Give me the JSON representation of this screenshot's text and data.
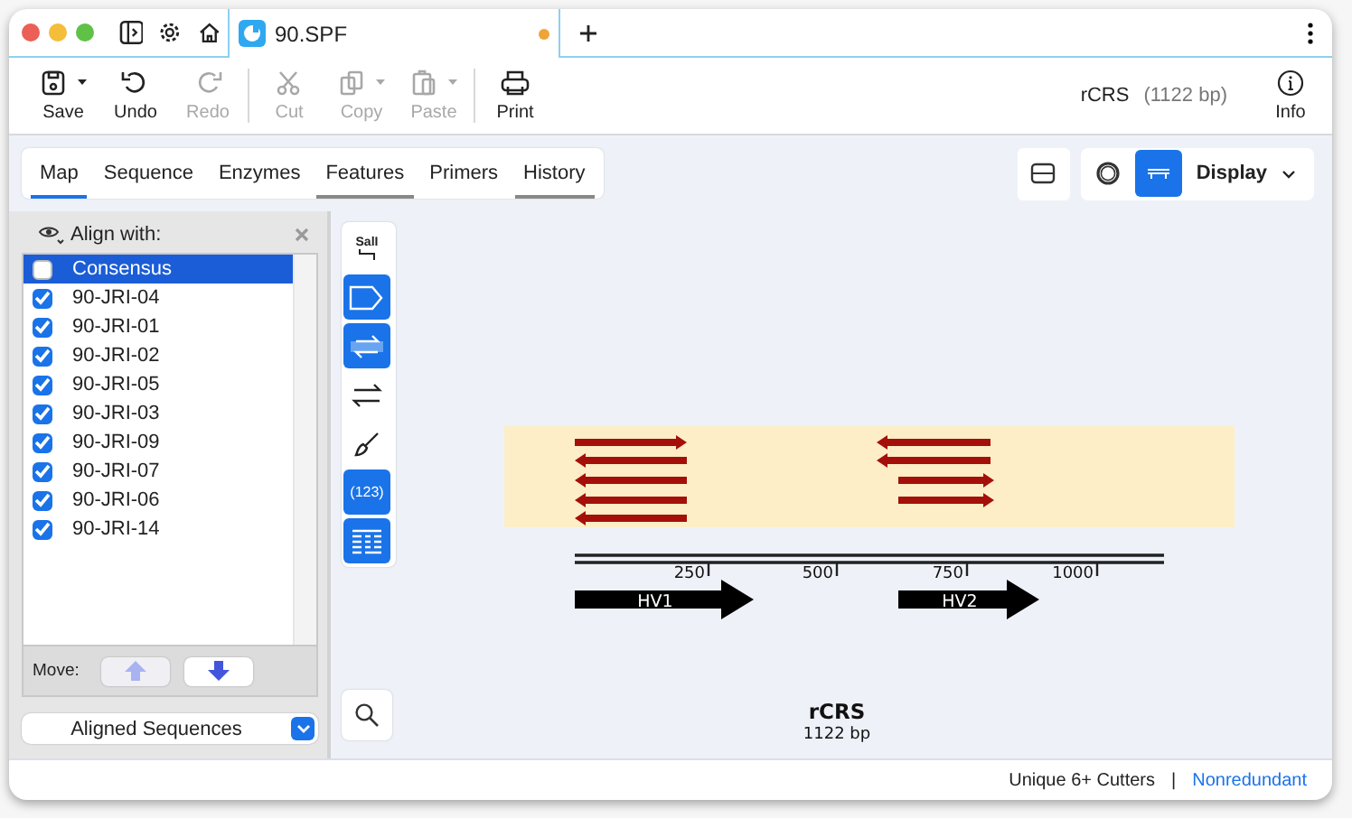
{
  "window": {
    "tab": {
      "title": "90.SPF",
      "modified": true
    }
  },
  "toolbar": {
    "groups": [
      [
        {
          "kind": "save",
          "label": "Save",
          "menu": true,
          "disabled": false
        },
        {
          "kind": "undo",
          "label": "Undo",
          "menu": false,
          "disabled": false
        },
        {
          "kind": "redo",
          "label": "Redo",
          "menu": false,
          "disabled": true
        }
      ],
      [
        {
          "kind": "cut",
          "label": "Cut",
          "menu": false,
          "disabled": true
        },
        {
          "kind": "copy",
          "label": "Copy",
          "menu": true,
          "disabled": true
        },
        {
          "kind": "paste",
          "label": "Paste",
          "menu": true,
          "disabled": true
        }
      ],
      [
        {
          "kind": "print",
          "label": "Print",
          "menu": false,
          "disabled": false
        }
      ]
    ],
    "sequence_name": "rCRS",
    "sequence_length": "(1122 bp)",
    "info_label": "Info"
  },
  "tabs": [
    {
      "label": "Map",
      "selected": true,
      "has_content": false
    },
    {
      "label": "Sequence",
      "selected": false,
      "has_content": false
    },
    {
      "label": "Enzymes",
      "selected": false,
      "has_content": false
    },
    {
      "label": "Features",
      "selected": false,
      "has_content": true
    },
    {
      "label": "Primers",
      "selected": false,
      "has_content": false
    },
    {
      "label": "History",
      "selected": false,
      "has_content": true
    }
  ],
  "view": {
    "modes": [
      {
        "kind": "circular",
        "selected": false
      },
      {
        "kind": "linear",
        "selected": true
      }
    ],
    "display_label": "Display"
  },
  "align_panel": {
    "title": "Align with:",
    "items": [
      {
        "name": "Consensus",
        "checked": false,
        "selected": true
      },
      {
        "name": "90-JRI-04",
        "checked": true,
        "selected": false
      },
      {
        "name": "90-JRI-01",
        "checked": true,
        "selected": false
      },
      {
        "name": "90-JRI-02",
        "checked": true,
        "selected": false
      },
      {
        "name": "90-JRI-05",
        "checked": true,
        "selected": false
      },
      {
        "name": "90-JRI-03",
        "checked": true,
        "selected": false
      },
      {
        "name": "90-JRI-09",
        "checked": true,
        "selected": false
      },
      {
        "name": "90-JRI-07",
        "checked": true,
        "selected": false
      },
      {
        "name": "90-JRI-06",
        "checked": true,
        "selected": false
      },
      {
        "name": "90-JRI-14",
        "checked": true,
        "selected": false
      }
    ],
    "move_label": "Move:",
    "move_up_disabled": true,
    "dropdown": "Aligned Sequences"
  },
  "map_tools": [
    {
      "kind": "enzyme",
      "label": "SalI",
      "on": false
    },
    {
      "kind": "feature",
      "on": true
    },
    {
      "kind": "primer",
      "on": true
    },
    {
      "kind": "orf",
      "on": false
    },
    {
      "kind": "brush",
      "on": false
    },
    {
      "kind": "numbers",
      "label": "(123)",
      "on": true
    },
    {
      "kind": "table",
      "on": true
    }
  ],
  "map": {
    "ruler_ticks": [
      "250",
      "500",
      "750",
      "1000"
    ],
    "features": [
      {
        "label": "HV1"
      },
      {
        "label": "HV2"
      }
    ],
    "title": "rCRS",
    "length": "1122 bp"
  },
  "status_bar": {
    "enzymes": "Unique 6+ Cutters",
    "separator": "|",
    "link": "Nonredundant"
  }
}
